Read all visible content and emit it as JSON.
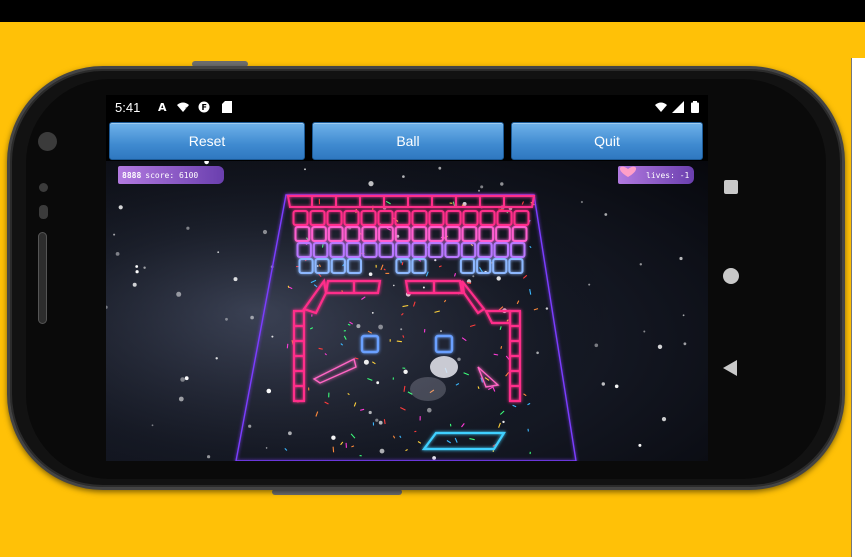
{
  "status_bar": {
    "time": "5:41",
    "left_icons": [
      "a-icon",
      "wifi-question-icon",
      "app-f-icon",
      "sd-card-icon"
    ],
    "right_icons": [
      "wifi-x-icon",
      "signal-icon",
      "battery-icon"
    ]
  },
  "toolbar": {
    "reset_label": "Reset",
    "ball_label": "Ball",
    "quit_label": "Quit"
  },
  "hud": {
    "score_counter": "8888",
    "score_text": "score: 6100",
    "lives_text": "lives: -1"
  },
  "nav_bar": {
    "buttons": [
      "recents",
      "home",
      "back"
    ]
  },
  "colors": {
    "background": "#ffc107",
    "button_blue": "#4a94d6",
    "neon_pink": "#ff2d8a",
    "neon_blue": "#5b8cff",
    "paddle_cyan": "#3fd0ff"
  }
}
